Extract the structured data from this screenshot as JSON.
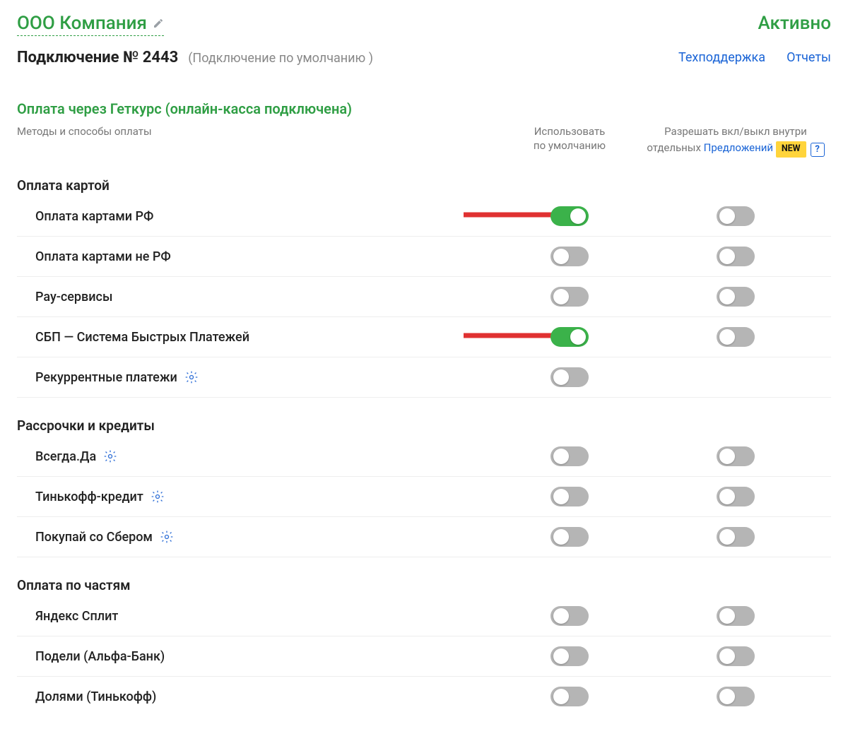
{
  "company_name": "ООО Компания",
  "status": "Активно",
  "connection_title": "Подключение № 2443",
  "connection_note": "(Подключение по умолчанию )",
  "links": {
    "support": "Техподдержка",
    "reports": "Отчеты"
  },
  "section_title": "Оплата через Геткурс (онлайн-касса подключена)",
  "col_methods": "Методы и способы оплаты",
  "col_default_l1": "Использовать",
  "col_default_l2": "по умолчанию",
  "col_offers_l1": "Разрешать вкл/выкл внутри",
  "col_offers_l2_a": "отдельных ",
  "col_offers_l2_b": "Предложений",
  "badge_new": "NEW",
  "help_q": "?",
  "groups": [
    {
      "title": "Оплата картой",
      "rows": [
        {
          "label": "Оплата картами РФ",
          "gear": false,
          "t1": true,
          "t2": false,
          "arrow": true
        },
        {
          "label": "Оплата картами не РФ",
          "gear": false,
          "t1": false,
          "t2": false,
          "arrow": false
        },
        {
          "label": "Pay-сервисы",
          "gear": false,
          "t1": false,
          "t2": false,
          "arrow": false
        },
        {
          "label": "СБП — Система Быстрых Платежей",
          "gear": false,
          "t1": true,
          "t2": false,
          "arrow": true
        },
        {
          "label": "Рекуррентные платежи",
          "gear": true,
          "t1": false,
          "t2": null,
          "arrow": false
        }
      ]
    },
    {
      "title": "Рассрочки и кредиты",
      "rows": [
        {
          "label": "Всегда.Да",
          "gear": true,
          "t1": false,
          "t2": false,
          "arrow": false
        },
        {
          "label": "Тинькофф-кредит",
          "gear": true,
          "t1": false,
          "t2": false,
          "arrow": false
        },
        {
          "label": "Покупай со Сбером",
          "gear": true,
          "t1": false,
          "t2": false,
          "arrow": false
        }
      ]
    },
    {
      "title": "Оплата по частям",
      "rows": [
        {
          "label": "Яндекс Сплит",
          "gear": false,
          "t1": false,
          "t2": false,
          "arrow": false
        },
        {
          "label": "Подели (Альфа-Банк)",
          "gear": false,
          "t1": false,
          "t2": false,
          "arrow": false
        },
        {
          "label": "Долями (Тинькофф)",
          "gear": false,
          "t1": false,
          "t2": false,
          "arrow": false
        }
      ]
    }
  ]
}
